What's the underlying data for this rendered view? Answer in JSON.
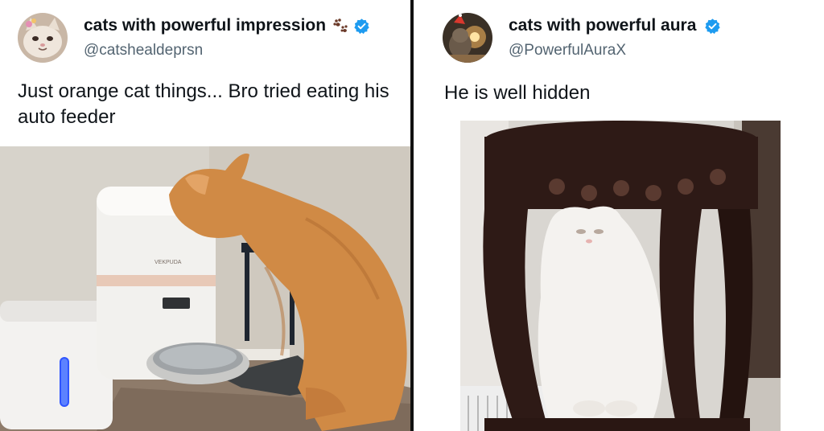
{
  "tweets": [
    {
      "display_name": "cats with powerful impression",
      "handle": "@catshealdeprsn",
      "text": "Just orange cat things... Bro tried eating his auto feeder",
      "feeder_brand": "VEKPUDA",
      "icons": [
        "paw-prints-icon",
        "verified-badge-icon"
      ]
    },
    {
      "display_name": "cats with powerful aura",
      "handle": "@PowerfulAuraX",
      "text": "He is well hidden",
      "icons": [
        "verified-badge-icon"
      ]
    }
  ],
  "colors": {
    "verified": "#1d9bf0",
    "orange_cat": "#d08a45",
    "white_cat": "#f4f2ef",
    "wood_stand": "#2e1a16"
  }
}
